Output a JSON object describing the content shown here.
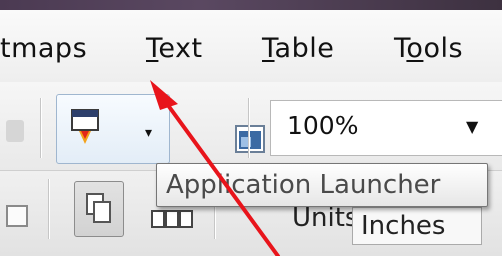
{
  "menubar": {
    "items": [
      {
        "label": "tmaps",
        "underline_index": -1
      },
      {
        "label": "Text",
        "underline_index": 0
      },
      {
        "label": "Table",
        "underline_index": 0
      },
      {
        "label": "Tools",
        "underline_index": 1
      }
    ]
  },
  "toolbar": {
    "app_launcher": {
      "dropdown_glyph": "▾",
      "icon": "application-launcher-icon"
    },
    "view_icon": "view-manager-icon",
    "zoom": {
      "value": "100%",
      "arrow": "▼"
    }
  },
  "toolbar2": {
    "units_label": "Units:",
    "units_value": "Inches"
  },
  "tooltip": {
    "text": "Application Launcher"
  },
  "annotation": {
    "arrow_color": "#e8141b"
  },
  "colors": {
    "titlebar": "#4b3a52",
    "button_border": "#9fb6cf"
  }
}
